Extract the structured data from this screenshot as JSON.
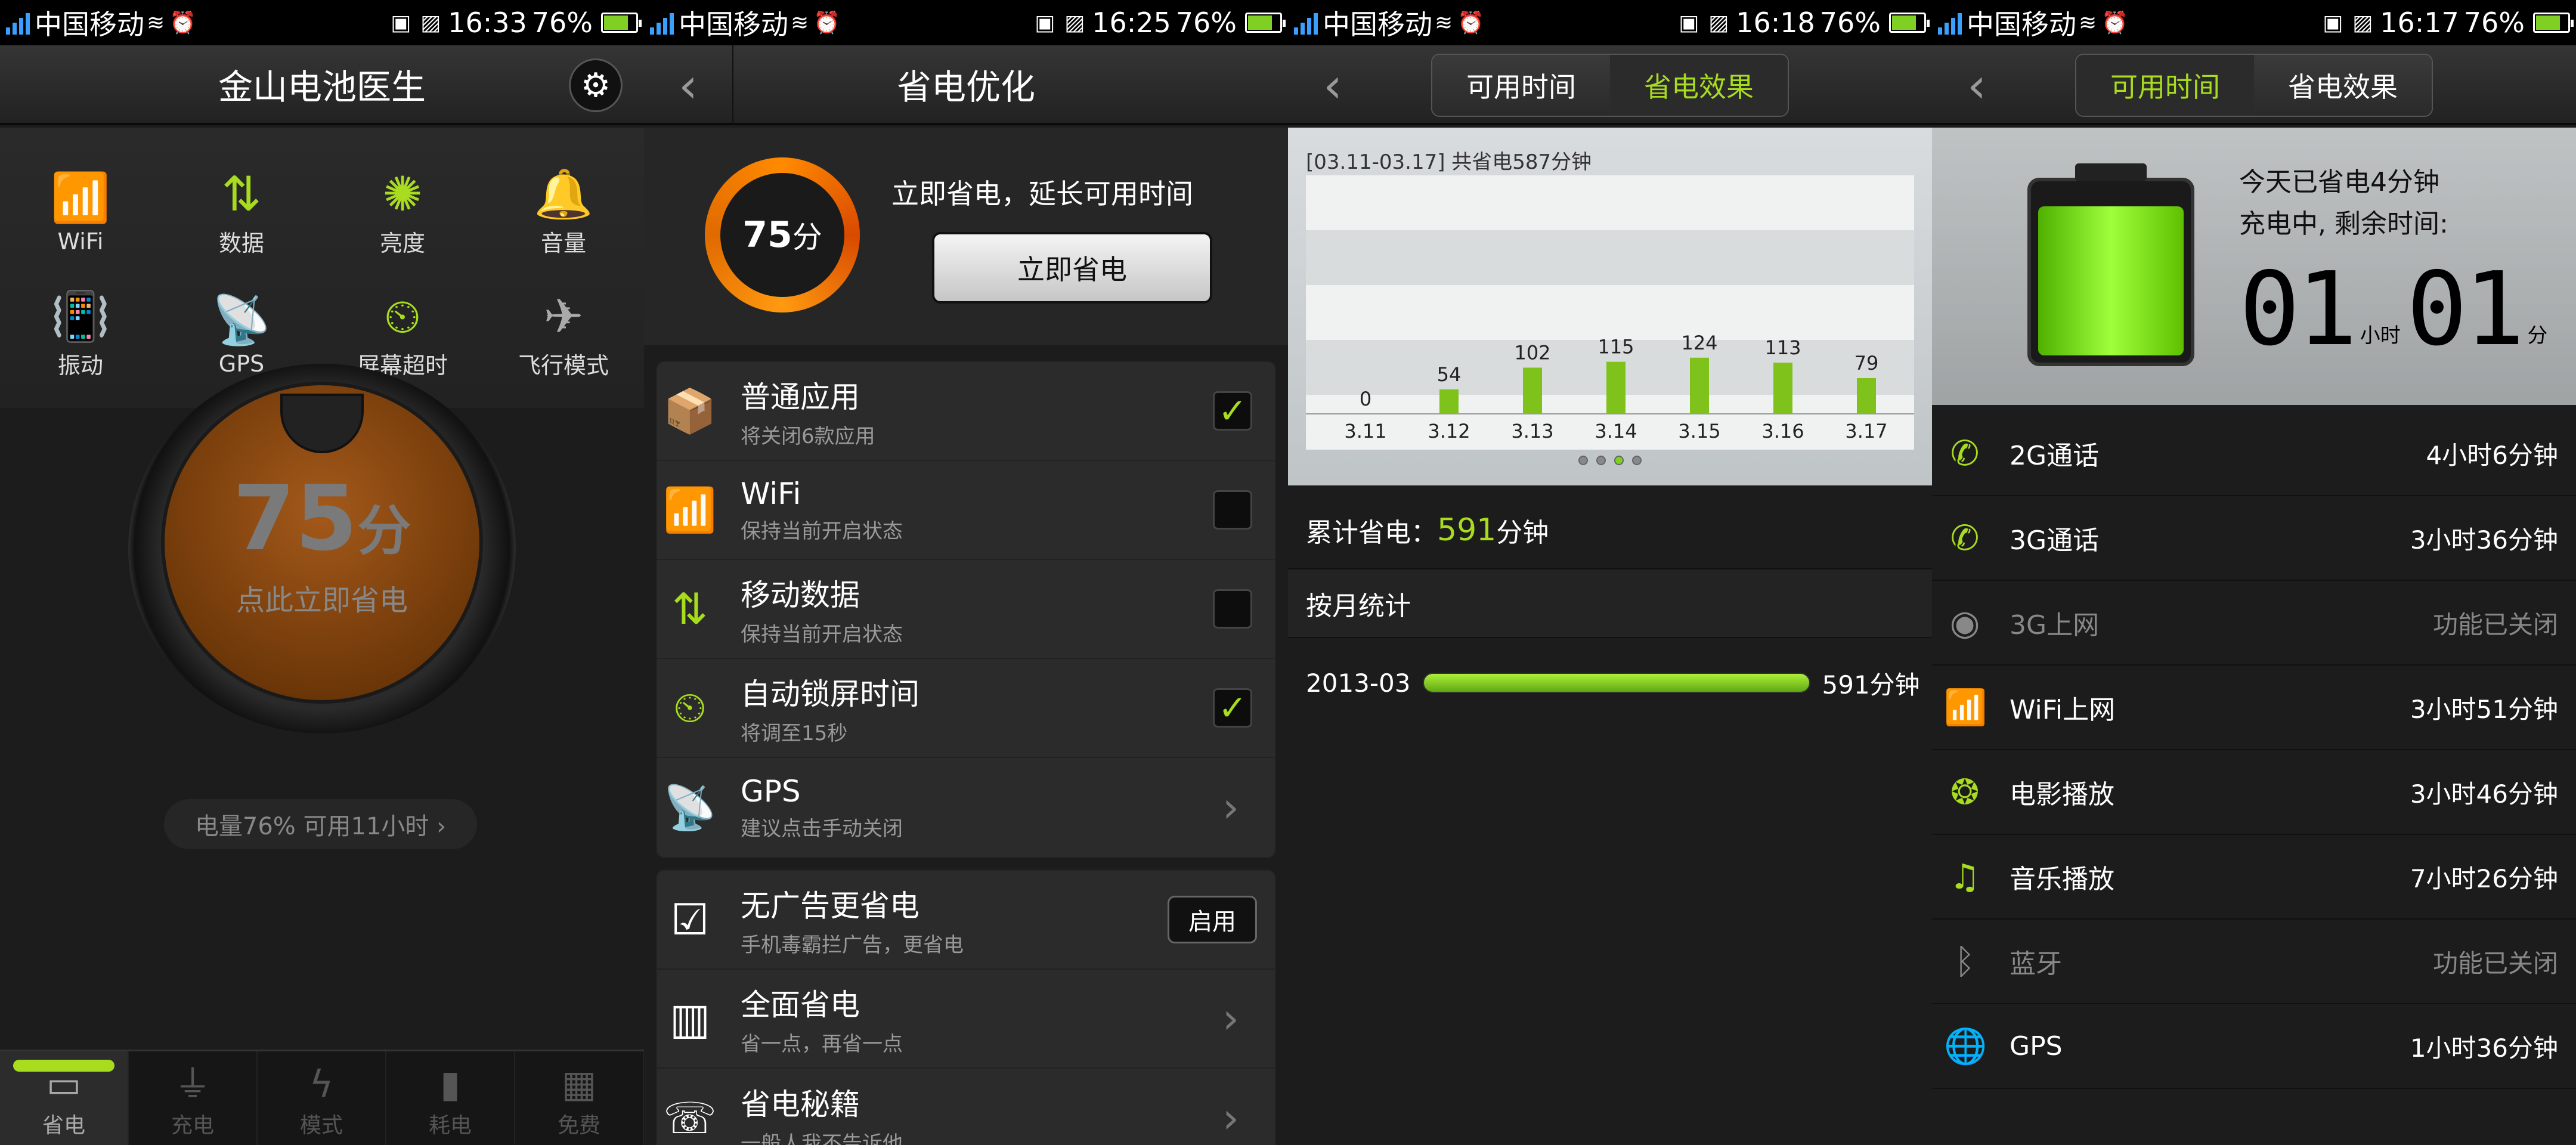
{
  "status": [
    {
      "carrier": "中国移动",
      "time": "16:33",
      "battery": "76%"
    },
    {
      "carrier": "中国移动",
      "time": "16:25",
      "battery": "76%"
    },
    {
      "carrier": "中国移动",
      "time": "16:18",
      "battery": "76%"
    },
    {
      "carrier": "中国移动",
      "time": "16:17",
      "battery": "76%"
    }
  ],
  "p1": {
    "title": "金山电池医生",
    "quick": [
      {
        "label": "WiFi",
        "icon": "wifi-icon",
        "glyph": "📶",
        "on": true
      },
      {
        "label": "数据",
        "icon": "data-icon",
        "glyph": "⇅",
        "on": true
      },
      {
        "label": "亮度",
        "icon": "brightness-icon",
        "glyph": "✺",
        "on": true
      },
      {
        "label": "音量",
        "icon": "bell-icon",
        "glyph": "🔔",
        "on": true
      },
      {
        "label": "振动",
        "icon": "vibrate-icon",
        "glyph": "📳",
        "on": false
      },
      {
        "label": "GPS",
        "icon": "gps-icon",
        "glyph": "📡",
        "on": true
      },
      {
        "label": "屏幕超时",
        "icon": "timer-icon",
        "glyph": "⏲",
        "on": true
      },
      {
        "label": "飞行模式",
        "icon": "airplane-icon",
        "glyph": "✈",
        "on": false
      }
    ],
    "score": "75",
    "score_unit": "分",
    "dial_text": "点此立即省电",
    "info": "电量76% 可用11小时 ›",
    "nav": [
      "省电",
      "充电",
      "模式",
      "耗电",
      "免费"
    ]
  },
  "p2": {
    "title": "省电优化",
    "score": "75",
    "score_unit": "分",
    "tip": "立即省电，延长可用时间",
    "button": "立即省电",
    "items": [
      {
        "title": "普通应用",
        "sub": "将关闭6款应用",
        "ctrl": "check",
        "checked": true
      },
      {
        "title": "WiFi",
        "sub": "保持当前开启状态",
        "ctrl": "check",
        "checked": false
      },
      {
        "title": "移动数据",
        "sub": "保持当前开启状态",
        "ctrl": "check",
        "checked": false
      },
      {
        "title": "自动锁屏时间",
        "sub": "将调至15秒",
        "ctrl": "check",
        "checked": true
      },
      {
        "title": "GPS",
        "sub": "建议点击手动关闭",
        "ctrl": "chev"
      }
    ],
    "items2": [
      {
        "title": "无广告更省电",
        "sub": "手机毒霸拦广告，更省电",
        "ctrl": "btn",
        "btn": "启用"
      },
      {
        "title": "全面省电",
        "sub": "省一点，再省一点",
        "ctrl": "chev"
      },
      {
        "title": "省电秘籍",
        "sub": "一般人我不告诉他",
        "ctrl": "chev"
      }
    ]
  },
  "p3": {
    "tab_a": "可用时间",
    "tab_b": "省电效果",
    "chart_title": "[03.11-03.17] 共省电587分钟",
    "total_label": "累计省电：",
    "total_value": "591",
    "total_unit": "分钟",
    "monthly_label": "按月统计",
    "month": "2013-03",
    "month_value": "591分钟"
  },
  "chart_data": {
    "type": "bar",
    "title": "[03.11-03.17] 共省电587分钟",
    "categories": [
      "3.11",
      "3.12",
      "3.13",
      "3.14",
      "3.15",
      "3.16",
      "3.17"
    ],
    "values": [
      0,
      54,
      102,
      115,
      124,
      113,
      79
    ],
    "ylim": [
      0,
      500
    ],
    "grid": true,
    "color": "#7fc21b"
  },
  "p4": {
    "tab_a": "可用时间",
    "tab_b": "省电效果",
    "saved": "今天已省电4分钟",
    "charging": "充电中, 剩余时间:",
    "hours": "01",
    "hour_unit": "小时",
    "mins": "01",
    "min_unit": "分",
    "usage": [
      {
        "icon": "phone-2g-icon",
        "glyph": "✆",
        "label": "2G通话",
        "value": "4小时6分钟",
        "on": true
      },
      {
        "icon": "phone-3g-icon",
        "glyph": "✆",
        "label": "3G通话",
        "value": "3小时36分钟",
        "on": true
      },
      {
        "icon": "antenna-icon",
        "glyph": "◉",
        "label": "3G上网",
        "value": "功能已关闭",
        "on": false
      },
      {
        "icon": "wifi-icon",
        "glyph": "📶",
        "label": "WiFi上网",
        "value": "3小时51分钟",
        "on": true
      },
      {
        "icon": "film-icon",
        "glyph": "❂",
        "label": "电影播放",
        "value": "3小时46分钟",
        "on": true
      },
      {
        "icon": "music-icon",
        "glyph": "♫",
        "label": "音乐播放",
        "value": "7小时26分钟",
        "on": true
      },
      {
        "icon": "bluetooth-icon",
        "glyph": "ᛒ",
        "label": "蓝牙",
        "value": "功能已关闭",
        "on": false
      },
      {
        "icon": "globe-icon",
        "glyph": "🌐",
        "label": "GPS",
        "value": "1小时36分钟",
        "on": true
      }
    ]
  }
}
